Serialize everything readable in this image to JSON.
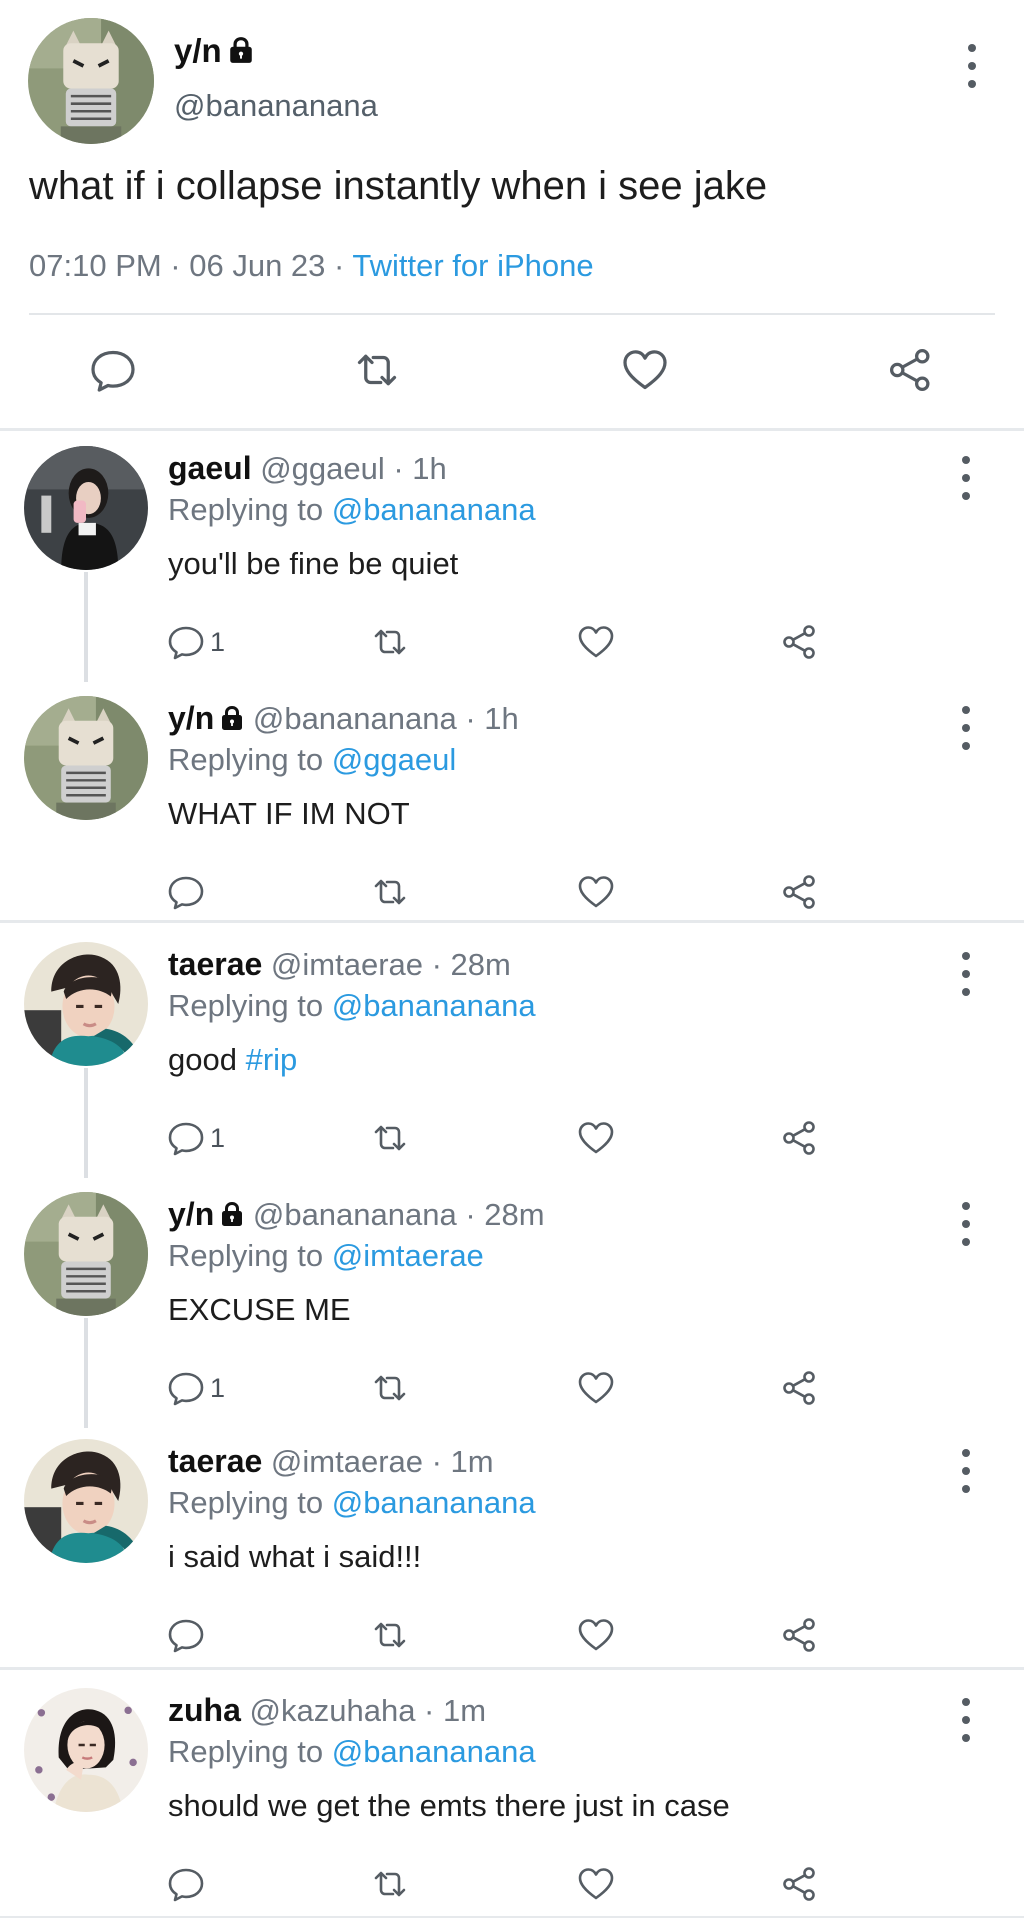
{
  "main_tweet": {
    "name": "y/n",
    "handle": "@bananana​na",
    "text": "what if i collapse instantly when i see jake",
    "meta_time": "07:10 PM · 06 Jun 23 · ",
    "meta_source": "Twitter for iPhone"
  },
  "replies": [
    {
      "name": "gaeul",
      "handle_time": "@ggaeul · 1h",
      "replying_label": "Replying to",
      "replying_to": "@banananana",
      "text": "you'll be fine be quiet",
      "text_tag": "",
      "reply_count": "1"
    },
    {
      "name": "y/n",
      "handle_time": "@banananana · 1h",
      "replying_label": "Replying to",
      "replying_to": "@ggaeul",
      "text": "WHAT IF IM NOT",
      "text_tag": "",
      "reply_count": ""
    },
    {
      "name": "taerae",
      "handle_time": "@imtaerae · 28m",
      "replying_label": "Replying to",
      "replying_to": "@banananana",
      "text": "good ",
      "text_tag": "#rip",
      "reply_count": "1"
    },
    {
      "name": "y/n",
      "handle_time": "@banananana · 28m",
      "replying_label": "Replying to",
      "replying_to": "@imtaerae",
      "text": "EXCUSE ME",
      "text_tag": "",
      "reply_count": "1"
    },
    {
      "name": "taerae",
      "handle_time": "@imtaerae · 1m",
      "replying_label": "Replying to",
      "replying_to": "@banananana",
      "text": "i said what i said!!!",
      "text_tag": "",
      "reply_count": ""
    },
    {
      "name": "zuha",
      "handle_time": "@kazuhaha · 1m",
      "replying_label": "Replying to",
      "replying_to": "@banananana",
      "text": "should we get the emts there just in case",
      "text_tag": "",
      "reply_count": ""
    }
  ],
  "colors": {
    "link": "#2b9ae0",
    "icon": "#555c63",
    "divider": "#e3e6e9"
  },
  "icons": [
    "comment-icon",
    "retweet-icon",
    "heart-icon",
    "share-icon",
    "more-icon",
    "lock-icon"
  ]
}
